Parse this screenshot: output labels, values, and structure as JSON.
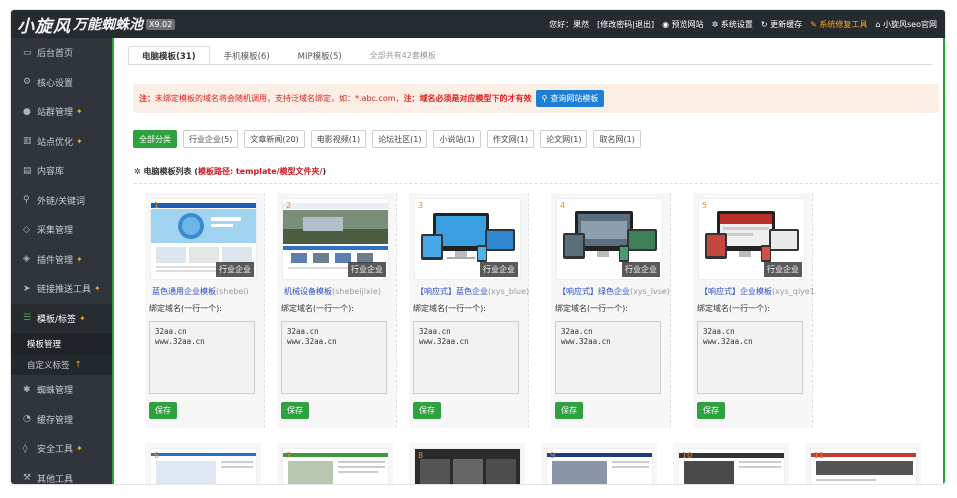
{
  "topbar": {
    "logo": "小旋风",
    "logo_sub": "万能蜘蛛池",
    "version": "X9.02",
    "greeting": "您好：果然",
    "change_pwd": "[修改密码|退出]",
    "preview": "预览网站",
    "settings": "系统设置",
    "cache": "更新缓存",
    "repair": "系统修复工具",
    "official": "小旋风seo官网"
  },
  "sidebar": {
    "items": [
      {
        "label": "后台首页",
        "icon": "monitor-icon",
        "pin": false
      },
      {
        "label": "核心设置",
        "icon": "gear-icon",
        "pin": false
      },
      {
        "label": "站群管理",
        "icon": "user-icon",
        "pin": true
      },
      {
        "label": "站点优化",
        "icon": "chart-icon",
        "pin": true
      },
      {
        "label": "内容库",
        "icon": "list-icon",
        "pin": false
      },
      {
        "label": "外链/关键词",
        "icon": "link-icon",
        "pin": false
      },
      {
        "label": "采集管理",
        "icon": "collect-icon",
        "pin": false
      },
      {
        "label": "插件管理",
        "icon": "plugin-icon",
        "pin": true
      },
      {
        "label": "链接推送工具",
        "icon": "send-icon",
        "pin": true
      },
      {
        "label": "模板/标签",
        "icon": "template-icon",
        "pin": true
      }
    ],
    "sub_items": [
      {
        "label": "模板管理"
      },
      {
        "label": "自定义标签",
        "pin": true
      }
    ],
    "items_after": [
      {
        "label": "蜘蛛管理",
        "icon": "spider-icon",
        "pin": false
      },
      {
        "label": "缓存管理",
        "icon": "cache-icon",
        "pin": false
      },
      {
        "label": "安全工具",
        "icon": "shield-icon",
        "pin": true
      },
      {
        "label": "其他工具",
        "icon": "tool-icon",
        "pin": false
      }
    ]
  },
  "tabs": [
    {
      "label": "电脑模板(31)",
      "active": true
    },
    {
      "label": "手机模板(6)",
      "active": false
    },
    {
      "label": "MIP模板(5)",
      "active": false
    }
  ],
  "tab_total": "全部共有42套模板",
  "notice": {
    "prefix": "注：",
    "text1": "未绑定模板的域名将会随机调用，支持泛域名绑定，如：*.abc.com，",
    "prefix2": "注：",
    "text2": "域名必须是对应模型下的才有效",
    "button": "查询网站模板"
  },
  "filters": [
    {
      "label": "全部分类",
      "active": true
    },
    {
      "label": "行业企业(5)",
      "active": false
    },
    {
      "label": "文章新闻(20)",
      "active": false
    },
    {
      "label": "电影视频(1)",
      "active": false
    },
    {
      "label": "论坛社区(1)",
      "active": false
    },
    {
      "label": "小说站(1)",
      "active": false
    },
    {
      "label": "作文网(1)",
      "active": false
    },
    {
      "label": "论文网(1)",
      "active": false
    },
    {
      "label": "取名网(1)",
      "active": false
    }
  ],
  "list_title": "电脑模板列表 (",
  "list_path": "模板路径: template/模型文件夹/",
  "list_close": ")",
  "cards": [
    {
      "num": "1",
      "tag": "行业企业",
      "name": "蓝色通用企业模板",
      "code": "(shebei)",
      "bind_label": "绑定域名(一行一个):",
      "domains": "32aa.cn\nwww.32aa.cn",
      "save": "保存"
    },
    {
      "num": "2",
      "tag": "行业企业",
      "name": "机械设备模板",
      "code": "(shebeijixie)",
      "bind_label": "绑定域名(一行一个):",
      "domains": "32aa.cn\nwww.32aa.cn",
      "save": "保存"
    },
    {
      "num": "3",
      "tag": "行业企业",
      "name": "【响应式】蓝色企业",
      "code": "(xys_blue)",
      "bind_label": "绑定域名(一行一个):",
      "domains": "32aa.cn\nwww.32aa.cn",
      "save": "保存"
    },
    {
      "num": "4",
      "tag": "行业企业",
      "name": "【响应式】绿色企业",
      "code": "(xys_lvse)",
      "bind_label": "绑定域名(一行一个):",
      "domains": "32aa.cn\nwww.32aa.cn",
      "save": "保存"
    },
    {
      "num": "5",
      "tag": "行业企业",
      "name": "【响应式】企业模板",
      "code": "(xys_qiye1)",
      "bind_label": "绑定域名(一行一个):",
      "domains": "32aa.cn\nwww.32aa.cn",
      "save": "保存"
    }
  ],
  "row2": [
    "6",
    "7",
    "8",
    "9",
    "10",
    "11"
  ]
}
